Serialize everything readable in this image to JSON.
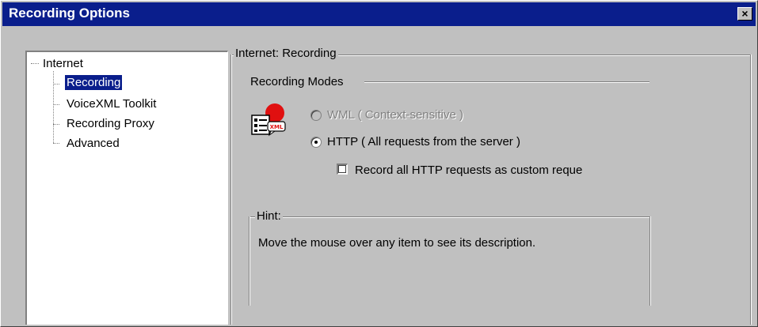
{
  "window": {
    "title": "Recording Options",
    "close_symbol": "×"
  },
  "tree": {
    "root": "Internet",
    "children": [
      "Recording",
      "VoiceXML Toolkit",
      "Recording Proxy",
      "Advanced"
    ],
    "selected": "Recording"
  },
  "panel": {
    "group_title": "Internet: Recording",
    "modes_title": "Recording Modes",
    "wml_option": {
      "label": "WML ( Context-sensitive )",
      "enabled": false,
      "selected": false
    },
    "http_option": {
      "label": "HTTP ( All requests from the server )",
      "enabled": true,
      "selected": true
    },
    "custom_checkbox": {
      "label": "Record all HTTP requests as custom reque",
      "checked": false
    },
    "hint_title": "Hint:",
    "hint_text": "Move the mouse over any item to see its description."
  },
  "colors": {
    "title_bar": "#0a1e8c",
    "face": "#c0c0c0",
    "selection": "#0a1e8c"
  },
  "icons": {
    "mode_icon": "xml-document-icon"
  }
}
